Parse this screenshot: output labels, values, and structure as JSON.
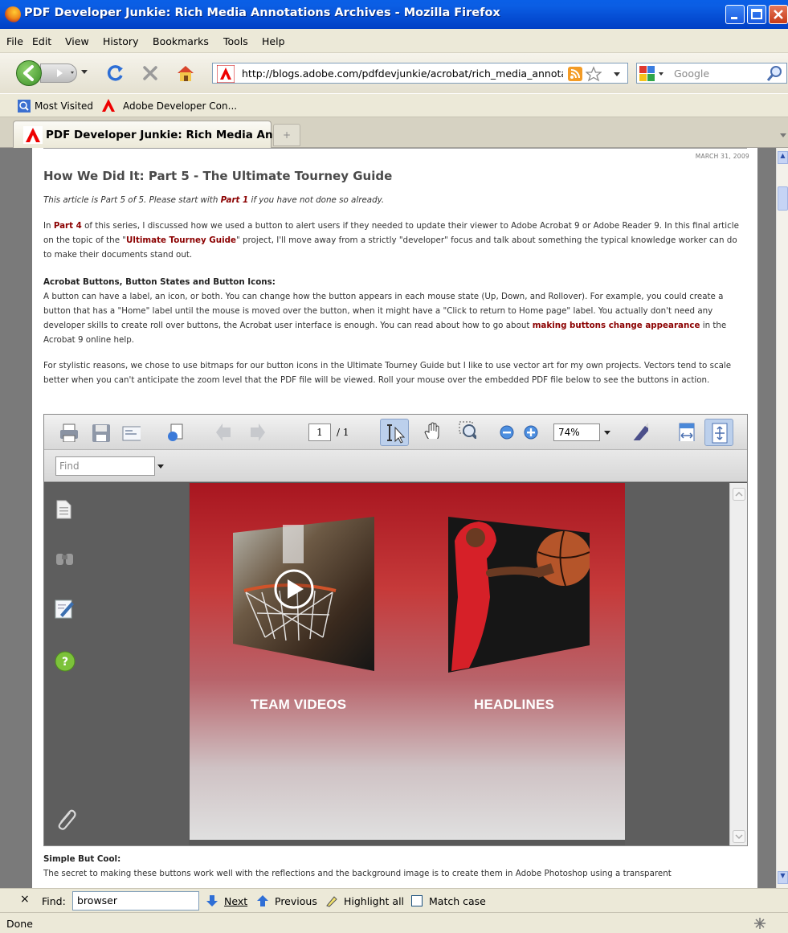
{
  "window": {
    "title": "PDF Developer Junkie: Rich Media Annotations Archives - Mozilla Firefox"
  },
  "menu": [
    "File",
    "Edit",
    "View",
    "History",
    "Bookmarks",
    "Tools",
    "Help"
  ],
  "nav": {
    "url": "http://blogs.adobe.com/pdfdevjunkie/acrobat/rich_media_annota",
    "search_placeholder": "Google"
  },
  "bookmarks": [
    "Most Visited",
    "Adobe Developer Con..."
  ],
  "tab": {
    "label": "PDF Developer Junkie: Rich Media An...",
    "new_tab": "+"
  },
  "article": {
    "date": "MARCH 31, 2009",
    "title": "How We Did It: Part 5 - The Ultimate Tourney Guide",
    "intro_pre": "This article is Part 5 of 5. Please start with ",
    "intro_link": "Part 1",
    "intro_post": " if you have not done so already.",
    "p1_a": "In ",
    "p1_link1": "Part 4",
    "p1_b": " of this series, I discussed how we used a button to alert users if they needed to update their viewer to Adobe Acrobat 9 or Adobe Reader 9. In this final article on the topic of the \"",
    "p1_link2": "Ultimate Tourney Guide",
    "p1_c": "\" project, I'll move away from a strictly \"developer\" focus and talk about something the typical knowledge worker can do to make their documents stand out.",
    "section1_title": "Acrobat Buttons, Button States and Button Icons",
    "p2_a": "A button can have a label, an icon, or both. You can change how the button appears in each mouse state (Up, Down, and Rollover). For example, you could create a button that has a \"Home\" label until the mouse is moved over the button, when it might have a \"Click to return to Home page\" label. You actually don't need any developer skills to create roll over buttons, the Acrobat user interface is enough. You can read about how to go about ",
    "p2_link": "making buttons change appearance",
    "p2_b": " in the Acrobat 9 online help.",
    "p3": "For stylistic reasons, we chose to use bitmaps for our button icons in the Ultimate Tourney Guide but I like to use vector art for my own projects. Vectors tend to scale better when you can't anticipate the zoom level that the PDF file will be viewed. Roll your mouse over the embedded PDF file below to see the buttons in action.",
    "section2_title": "Simple But Cool",
    "p4": "The secret to making these buttons work well with the reflections and the background image is to create them in Adobe Photoshop using a transparent"
  },
  "pdf": {
    "page_current": "1",
    "page_total": "/ 1",
    "zoom": "74%",
    "find_placeholder": "Find",
    "button_left": "TEAM VIDEOS",
    "button_right": "HEADLINES"
  },
  "findbar": {
    "close": "×",
    "label": "Find:",
    "value": "browser",
    "next": "Next",
    "previous": "Previous",
    "highlight": "Highlight all",
    "match_case": "Match case"
  },
  "status": "Done"
}
